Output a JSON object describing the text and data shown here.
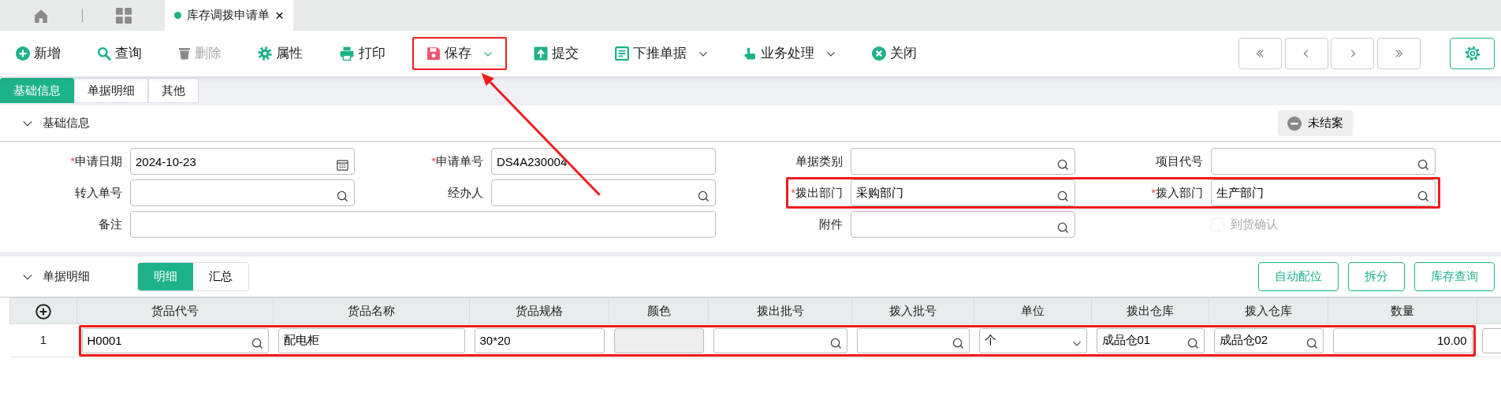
{
  "tab_bar": {
    "tabs": [
      {
        "kind": "home",
        "selected": false
      },
      {
        "kind": "apps",
        "selected": false
      },
      {
        "kind": "page",
        "label": "库存调拨申请单",
        "close": "×",
        "selected": true
      }
    ]
  },
  "toolbar": {
    "buttons": [
      {
        "kind": "add",
        "label": "新增",
        "disabled": false,
        "dropdown": false,
        "highlighted": false
      },
      {
        "kind": "query",
        "label": "查询",
        "disabled": false,
        "dropdown": false,
        "highlighted": false
      },
      {
        "kind": "delete",
        "label": "删除",
        "disabled": true,
        "dropdown": false,
        "highlighted": false
      },
      {
        "kind": "properties",
        "label": "属性",
        "disabled": false,
        "dropdown": false,
        "highlighted": false
      },
      {
        "kind": "print",
        "label": "打印",
        "disabled": false,
        "dropdown": false,
        "highlighted": false
      },
      {
        "kind": "save",
        "label": "保存",
        "disabled": false,
        "dropdown": true,
        "highlighted": true
      },
      {
        "kind": "submit",
        "label": "提交",
        "disabled": false,
        "dropdown": false,
        "highlighted": false
      },
      {
        "kind": "push",
        "label": "下推单据",
        "disabled": false,
        "dropdown": true,
        "highlighted": false
      },
      {
        "kind": "process",
        "label": "业务处理",
        "disabled": false,
        "dropdown": true,
        "highlighted": false
      },
      {
        "kind": "close",
        "label": "关闭",
        "disabled": false,
        "dropdown": false,
        "highlighted": false
      }
    ]
  },
  "form_tabs": [
    {
      "label": "基础信息",
      "selected": true
    },
    {
      "label": "单据明细",
      "selected": false
    },
    {
      "label": "其他",
      "selected": false
    }
  ],
  "basic_section": {
    "title": "基础信息",
    "expanded": true,
    "status": "未结案",
    "fields": [
      {
        "kind": "date",
        "label": "申请日期",
        "required_mark": "*",
        "value": "2024-10-23"
      },
      {
        "kind": "text",
        "label": "申请单号",
        "required_mark": "*",
        "value": "DS4A230004"
      },
      {
        "kind": "lookup",
        "label": "单据类别"
      },
      {
        "kind": "lookup",
        "label": "项目代号"
      },
      {
        "kind": "lookup",
        "label": "转入单号"
      },
      {
        "kind": "lookup",
        "label": "经办人"
      },
      {
        "kind": "lookup",
        "label": "拨出部门",
        "required_mark": "*",
        "value": "采购部门",
        "highlighted": true
      },
      {
        "kind": "lookup",
        "label": "拨入部门",
        "required_mark": "*",
        "value": "生产部门",
        "highlighted": true
      },
      {
        "kind": "wide",
        "label": "备注"
      },
      {
        "kind": "lookup",
        "label": "附件"
      },
      {
        "kind": "checkbox",
        "label": "到货确认",
        "checked": false,
        "disabled": true
      }
    ]
  },
  "detail_section": {
    "title": "单据明细",
    "expanded": true,
    "views": [
      {
        "label": "明细",
        "selected": true
      },
      {
        "label": "汇总",
        "selected": false
      }
    ],
    "actions": [
      "自动配位",
      "拆分",
      "库存查询"
    ],
    "columns": [
      "货品代号",
      "货品名称",
      "货品规格",
      "颜色",
      "拨出批号",
      "拨入批号",
      "单位",
      "拨出仓库",
      "拨入仓库",
      "数量"
    ],
    "rows": [
      {
        "index": "1",
        "highlighted": true,
        "cells": [
          {
            "kind": "lookup",
            "value": "H0001"
          },
          {
            "kind": "text",
            "value": "配电柜"
          },
          {
            "kind": "text",
            "value": "30*20"
          },
          {
            "kind": "readonly"
          },
          {
            "kind": "lookup"
          },
          {
            "kind": "lookup"
          },
          {
            "kind": "select",
            "value": "个"
          },
          {
            "kind": "lookup",
            "value": "成品仓01"
          },
          {
            "kind": "lookup",
            "value": "成品仓02"
          },
          {
            "kind": "number",
            "value": "10.00"
          }
        ]
      }
    ]
  },
  "annotations": {
    "arrow_to_save": true
  }
}
